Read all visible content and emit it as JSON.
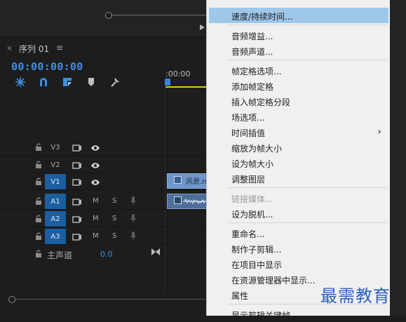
{
  "sequence": {
    "tab_title": "序列 01",
    "close": "×",
    "menu_icon": "≡",
    "timecode": "00:00:00:00",
    "ruler_time": ":00:00"
  },
  "colors": {
    "accent_blue": "#3d8fe2",
    "track_on": "#1b5fa0",
    "clip_video": "#6f95c9",
    "clip_audio": "#4e6f9c",
    "menu_bg": "#f0f0f0",
    "menu_highlight": "#9ec7ea",
    "watermark": "#2e5fc4",
    "work_area": "#d6d000"
  },
  "toolbar": {
    "icons": [
      "snap-icon",
      "linked-selection-icon",
      "marker-tool-icon",
      "add-marker-icon",
      "settings-wrench-icon"
    ]
  },
  "tracks": [
    {
      "id": "V3",
      "name": "V3",
      "type": "video",
      "targeted": false
    },
    {
      "id": "V2",
      "name": "V2",
      "type": "video",
      "targeted": false
    },
    {
      "id": "V1",
      "name": "V1",
      "type": "video",
      "targeted": true
    },
    {
      "id": "A1",
      "name": "A1",
      "type": "audio",
      "targeted": true,
      "mute": "M",
      "solo": "S"
    },
    {
      "id": "A2",
      "name": "A2",
      "type": "audio",
      "targeted": true,
      "mute": "M",
      "solo": "S"
    },
    {
      "id": "A3",
      "name": "A3",
      "type": "audio",
      "targeted": true,
      "mute": "M",
      "solo": "S"
    }
  ],
  "clip": {
    "video_name": "风景.m"
  },
  "mixer": {
    "label": "主声道",
    "value": "0.0"
  },
  "context_menu": [
    {
      "label": "速度/持续时间...",
      "highlighted": true
    },
    {
      "separator": true
    },
    {
      "label": "音频增益..."
    },
    {
      "label": "音频声道..."
    },
    {
      "separator": true
    },
    {
      "label": "帧定格选项..."
    },
    {
      "label": "添加帧定格"
    },
    {
      "label": "插入帧定格分段"
    },
    {
      "label": "场选项..."
    },
    {
      "label": "时间插值",
      "submenu": true
    },
    {
      "label": "缩放为帧大小"
    },
    {
      "label": "设为帧大小"
    },
    {
      "label": "调整图层"
    },
    {
      "separator": true
    },
    {
      "label": "链接媒体...",
      "disabled": true
    },
    {
      "label": "设为脱机..."
    },
    {
      "separator": true
    },
    {
      "label": "重命名..."
    },
    {
      "label": "制作子剪辑..."
    },
    {
      "label": "在项目中显示"
    },
    {
      "label": "在资源管理器中显示..."
    },
    {
      "label": "属性"
    },
    {
      "separator": true
    },
    {
      "label": "显示剪辑关键帧"
    }
  ],
  "watermark": "最需教育"
}
